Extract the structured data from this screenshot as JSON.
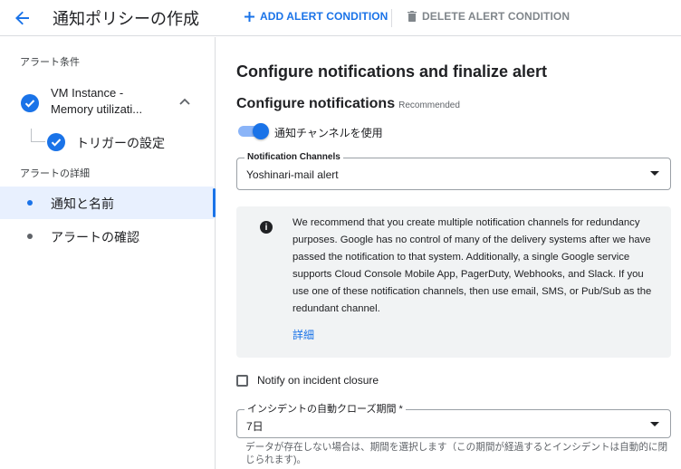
{
  "header": {
    "title": "通知ポリシーの作成",
    "add_condition": "ADD ALERT CONDITION",
    "delete_condition": "DELETE ALERT CONDITION"
  },
  "sidebar": {
    "conditions_label": "アラート条件",
    "condition_item": {
      "line1": "VM Instance -",
      "line2": "Memory utilizati..."
    },
    "trigger_item": "トリガーの設定",
    "details_label": "アラートの詳細",
    "nav": [
      {
        "label": "通知と名前",
        "active": true
      },
      {
        "label": "アラートの確認",
        "active": false
      }
    ]
  },
  "main": {
    "heading": "Configure notifications and finalize alert",
    "subheading": "Configure notifications",
    "recommended": "Recommended",
    "toggle_label": "通知チャンネルを使用",
    "channels_label": "Notification Channels",
    "channels_value": "Yoshinari-mail alert",
    "info_text": "We recommend that you create multiple notification channels for redundancy purposes. Google has no control of many of the delivery systems after we have passed the notification to that system. Additionally, a single Google service supports Cloud Console Mobile App, PagerDuty, Webhooks, and Slack. If you use one of these notification channels, then use email, SMS, or Pub/Sub as the redundant channel.",
    "info_link": "詳細",
    "incident_checkbox": "Notify on incident closure",
    "auto_close_label": "インシデントの自動クローズ期間 *",
    "auto_close_value": "7日",
    "auto_close_helper": "データが存在しない場合は、期間を選択します（この期間が経過するとインシデントは自動的に閉じられます)。"
  },
  "colors": {
    "accent": "#1a73e8",
    "active_nav_bg": "#e8f0fe",
    "info_bg": "#f1f3f4"
  }
}
